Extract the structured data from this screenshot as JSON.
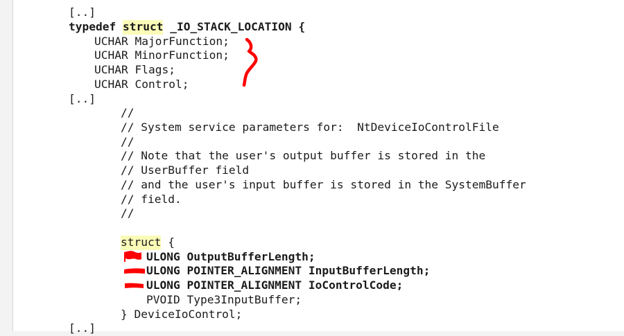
{
  "lines": {
    "l1": "[..]",
    "l2_pre": "typedef ",
    "l2_kw": "struct",
    "l2_post": " _IO_STACK_LOCATION {",
    "l3": "UCHAR MajorFunction;",
    "l4": "UCHAR MinorFunction;",
    "l5": "UCHAR Flags;",
    "l6": "UCHAR Control;",
    "l7": "[..]",
    "l8": "//",
    "l9": "// System service parameters for:  NtDeviceIoControlFile",
    "l10": "//",
    "l11": "// Note that the user's output buffer is stored in the",
    "l12": "// UserBuffer field",
    "l13": "// and the user's input buffer is stored in the SystemBuffer",
    "l14": "// field.",
    "l15": "//",
    "l16_kw": "struct",
    "l16_post": " {",
    "l17": "ULONG OutputBufferLength;",
    "l18": "ULONG POINTER_ALIGNMENT InputBufferLength;",
    "l19": "ULONG POINTER_ALIGNMENT IoControlCode;",
    "l20": "PVOID Type3InputBuffer;",
    "l21": "} DeviceIoControl;",
    "l22": "[..]"
  },
  "colors": {
    "highlight": "#fbfbb8",
    "annotation": "#ff0000",
    "page": "#ffffff",
    "margin": "#f3f3f3"
  },
  "icons": {
    "brace_annotation": "red-handdrawn-brace",
    "marks": [
      "red-handdrawn-flag-mark",
      "red-handdrawn-underline-mark",
      "red-handdrawn-underline-mark"
    ]
  }
}
